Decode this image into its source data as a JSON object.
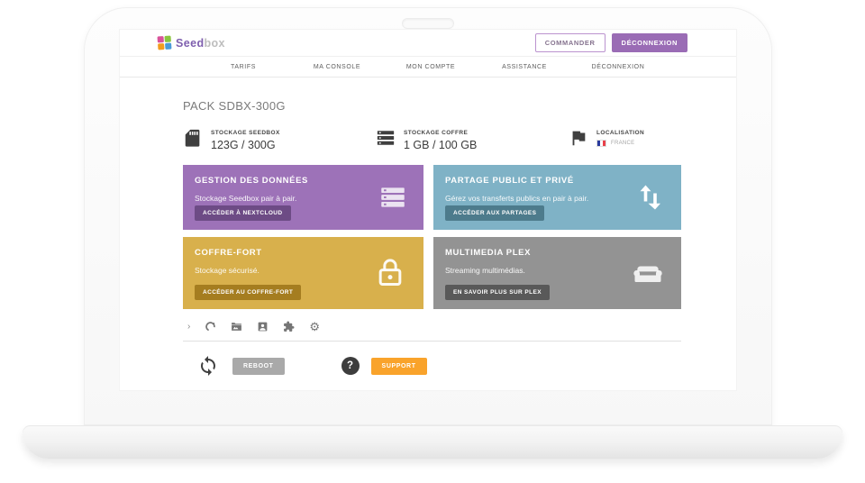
{
  "header": {
    "logo": {
      "text_primary": "Seed",
      "text_secondary": "box"
    },
    "commander_label": "COMMANDER",
    "deconnexion_label": "DÉCONNEXION"
  },
  "nav": {
    "items": [
      {
        "label": "TARIFS"
      },
      {
        "label": "MA CONSOLE"
      },
      {
        "label": "MON COMPTE"
      },
      {
        "label": "ASSISTANCE"
      },
      {
        "label": "DÉCONNEXION"
      }
    ]
  },
  "main": {
    "pack_title": "PACK SDBX-300G",
    "stats": [
      {
        "icon": "sd-card-icon",
        "label": "STOCKAGE SEEDBOX",
        "value": "123G / 300G"
      },
      {
        "icon": "storage-icon",
        "label": "STOCKAGE COFFRE",
        "value": "1 GB / 100 GB"
      },
      {
        "icon": "flag-icon",
        "label": "LOCALISATION",
        "country": "FRANCE"
      }
    ],
    "cards": [
      {
        "title": "GESTION DES DONNÉES",
        "description": "Stockage Seedbox pair à pair.",
        "button": "ACCÉDER À NEXTCLOUD",
        "icon": "storage-stack-icon",
        "color": "#9d72b8",
        "button_color": "#6d4b85"
      },
      {
        "title": "PARTAGE PUBLIC ET PRIVÉ",
        "description": "Gérez vos transferts publics en pair à pair.",
        "button": "ACCÉDER AUX PARTAGES",
        "icon": "transfer-arrows-icon",
        "color": "#7fb2c6",
        "button_color": "#4d7b8c"
      },
      {
        "title": "COFFRE-FORT",
        "description": "Stockage sécurisé.",
        "button": "ACCÉDER AU COFFRE-FORT",
        "icon": "lock-icon",
        "color": "#d8b04c",
        "button_color": "#a57d20"
      },
      {
        "title": "MULTIMEDIA PLEX",
        "description": "Streaming multimédias.",
        "button": "EN SAVOIR PLUS SUR PLEX",
        "icon": "couch-icon",
        "color": "#939393",
        "button_color": "#595959"
      }
    ],
    "actions": {
      "reboot_label": "REBOOT",
      "support_label": "SUPPORT",
      "help_label": "?",
      "reboot_color": "#a9a9a9",
      "support_color": "#f9a32b"
    }
  },
  "colors": {
    "accent_purple": "#9a6cb5",
    "flag_blue": "#2a3b9e",
    "flag_red": "#e8414b"
  }
}
